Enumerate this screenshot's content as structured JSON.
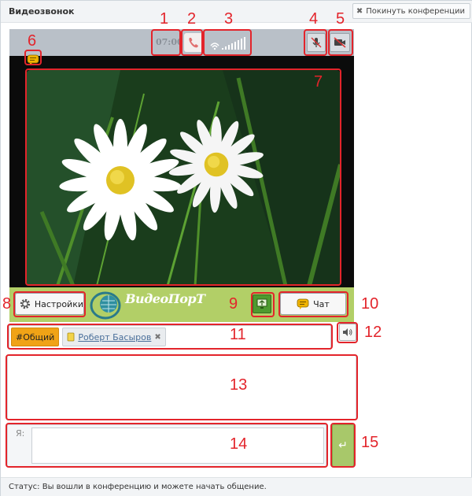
{
  "window": {
    "title": "Видеозвонок",
    "leave_label": "Покинуть конференции"
  },
  "video": {
    "timer": "07:00"
  },
  "controls": {
    "settings_label": "Настройки",
    "chat_label": "Чат",
    "logo_text": "ВидеоПорТ"
  },
  "tabs": {
    "general": "#Общий",
    "user": "Роберт Басыров"
  },
  "input": {
    "label": "Я:",
    "value": ""
  },
  "status": {
    "text": "Статус: Вы вошли в конференцию и можете начать общение."
  },
  "annotations": {
    "color": "#e3242b",
    "labels": [
      "1",
      "2",
      "3",
      "4",
      "5",
      "6",
      "7",
      "8",
      "9",
      "10",
      "11",
      "12",
      "13",
      "14",
      "15"
    ]
  },
  "colors": {
    "accent_green": "#b2cf67",
    "tab_orange": "#f0a316",
    "video_topbar": "#b9c0c8"
  },
  "icons": [
    "close-icon",
    "phone-icon",
    "signal-icon",
    "mic-muted-icon",
    "camera-muted-icon",
    "chat-icon",
    "gear-icon",
    "screen-share-icon",
    "user-icon",
    "speaker-icon",
    "enter-icon"
  ]
}
